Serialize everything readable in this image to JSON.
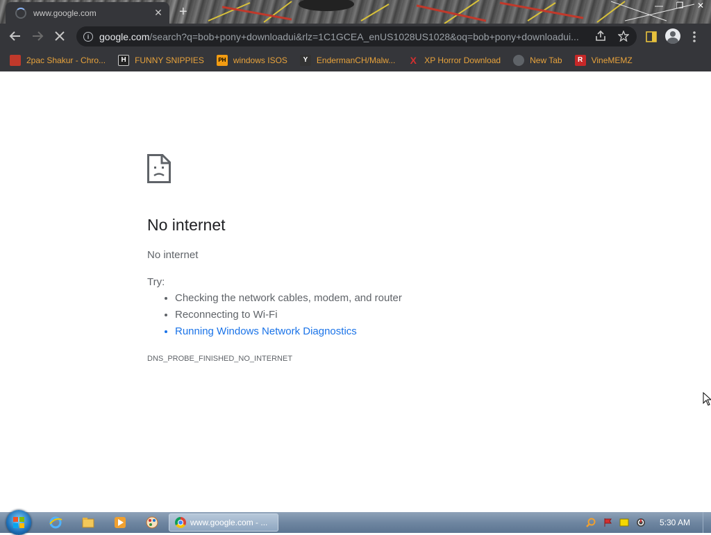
{
  "browser": {
    "tab": {
      "title": "www.google.com",
      "close_glyph": "✕"
    },
    "new_tab_glyph": "+",
    "window_controls": {
      "minimize": "—",
      "maximize": "❐",
      "close": "✕"
    },
    "omnibox": {
      "host": "google.com",
      "path": "/search?q=bob+pony+downloadui&rlz=1C1GCEA_enUS1028US1028&oq=bob+pony+downloadui..."
    },
    "bookmarks": [
      {
        "label": "2pac Shakur - Chro...",
        "icon": "bookmark-favicon-2pac",
        "icon_text": "",
        "icon_color": "#c0392b"
      },
      {
        "label": "FUNNY SNIPPIES",
        "icon": "bookmark-favicon-h",
        "icon_text": "H",
        "icon_color": "#222222"
      },
      {
        "label": "windows ISOS",
        "icon": "bookmark-favicon-ph",
        "icon_text": "PH",
        "icon_color": "#f39c12"
      },
      {
        "label": "EndermanCH/Malw...",
        "icon": "bookmark-favicon-yt",
        "icon_text": "Y",
        "icon_color": "#333333"
      },
      {
        "label": "XP Horror Download",
        "icon": "bookmark-favicon-x",
        "icon_text": "X",
        "icon_color": "#d32f2f"
      },
      {
        "label": "New Tab",
        "icon": "globe-icon",
        "icon_text": "",
        "icon_color": "#5f6368"
      },
      {
        "label": "VineMEMZ",
        "icon": "bookmark-favicon-r",
        "icon_text": "R",
        "icon_color": "#c62828"
      }
    ]
  },
  "page": {
    "title": "No internet",
    "subtitle": "No internet",
    "try_label": "Try:",
    "suggestions": [
      "Checking the network cables, modem, and router",
      "Reconnecting to Wi-Fi",
      "Running Windows Network Diagnostics"
    ],
    "error_code": "DNS_PROBE_FINISHED_NO_INTERNET"
  },
  "taskbar": {
    "active_task_label": "www.google.com - ...",
    "clock": "5:30 AM"
  },
  "colors": {
    "chrome_dark": "#35363a",
    "link": "#1a73e8",
    "bookmark_text": "#e8a33c"
  }
}
